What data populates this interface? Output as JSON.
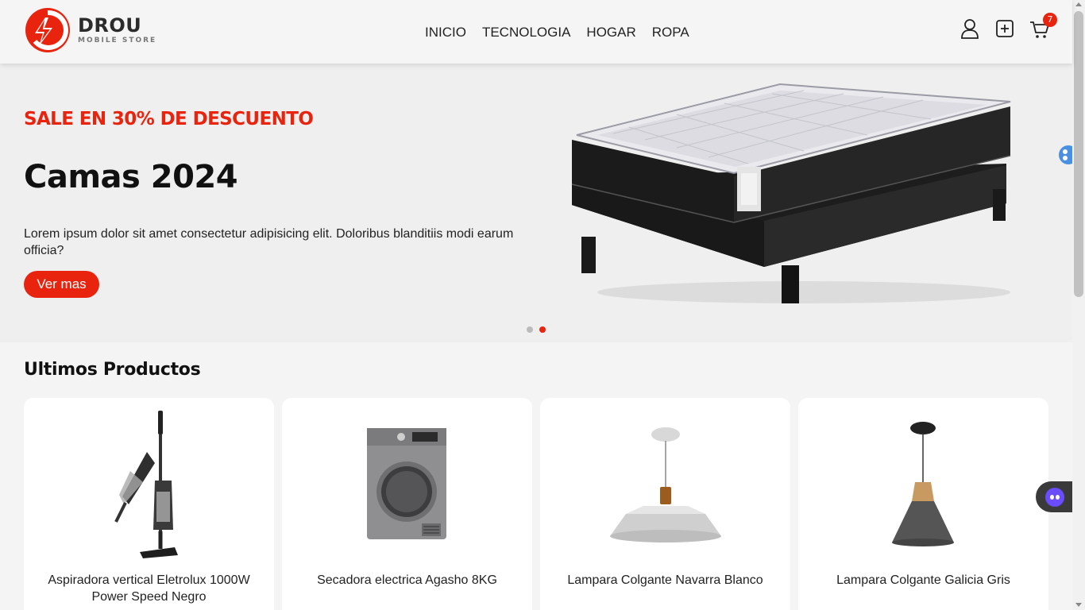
{
  "brand": {
    "name": "DROU",
    "tagline": "MOBILE STORE",
    "accent": "#e8240f"
  },
  "nav": {
    "links": [
      "INICIO",
      "TECNOLOGIA",
      "HOGAR",
      "ROPA"
    ]
  },
  "header_icons": {
    "user": "user-icon",
    "add": "plus-square-icon",
    "cart": "cart-icon",
    "cart_count": "7"
  },
  "hero": {
    "sale": "SALE EN 30% DE DESCUENTO",
    "title": "Camas 2024",
    "description": "Lorem ipsum dolor sit amet consectetur adipisicing elit. Doloribus blanditiis modi earum officia?",
    "button": "Ver mas",
    "slide_count": 2,
    "active_slide": 2
  },
  "section": {
    "title": "Ultimos Productos"
  },
  "products": [
    {
      "name": "Aspiradora vertical Eletrolux 1000W Power Speed Negro",
      "image": "vacuum-image"
    },
    {
      "name": "Secadora electrica Agasho 8KG",
      "image": "dryer-image"
    },
    {
      "name": "Lampara Colgante Navarra Blanco",
      "image": "white-pendant-lamp-image"
    },
    {
      "name": "Lampara Colgante Galicia Gris",
      "image": "gray-pendant-lamp-image"
    }
  ]
}
